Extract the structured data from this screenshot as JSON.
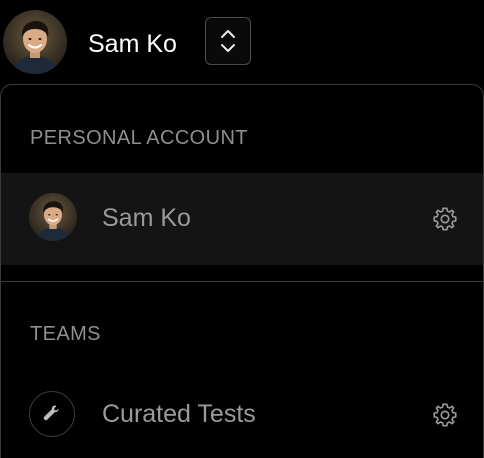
{
  "header": {
    "user_name": "Sam Ko",
    "avatar_icon": "user-avatar",
    "switcher_icon": "chevron-up-down-icon"
  },
  "dropdown": {
    "personal_heading": "PERSONAL ACCOUNT",
    "personal_account": {
      "name": "Sam Ko",
      "avatar_icon": "user-avatar",
      "settings_icon": "gear-icon"
    },
    "teams_heading": "TEAMS",
    "teams": [
      {
        "name": "Curated Tests",
        "icon": "wrench-icon",
        "settings_icon": "gear-icon"
      }
    ]
  },
  "colors": {
    "background": "#000000",
    "border": "#3a3a3a",
    "selected_row": "#141414",
    "heading_text": "#8f8f8f",
    "row_text": "#9a9a9a",
    "primary_text": "#ffffff"
  }
}
